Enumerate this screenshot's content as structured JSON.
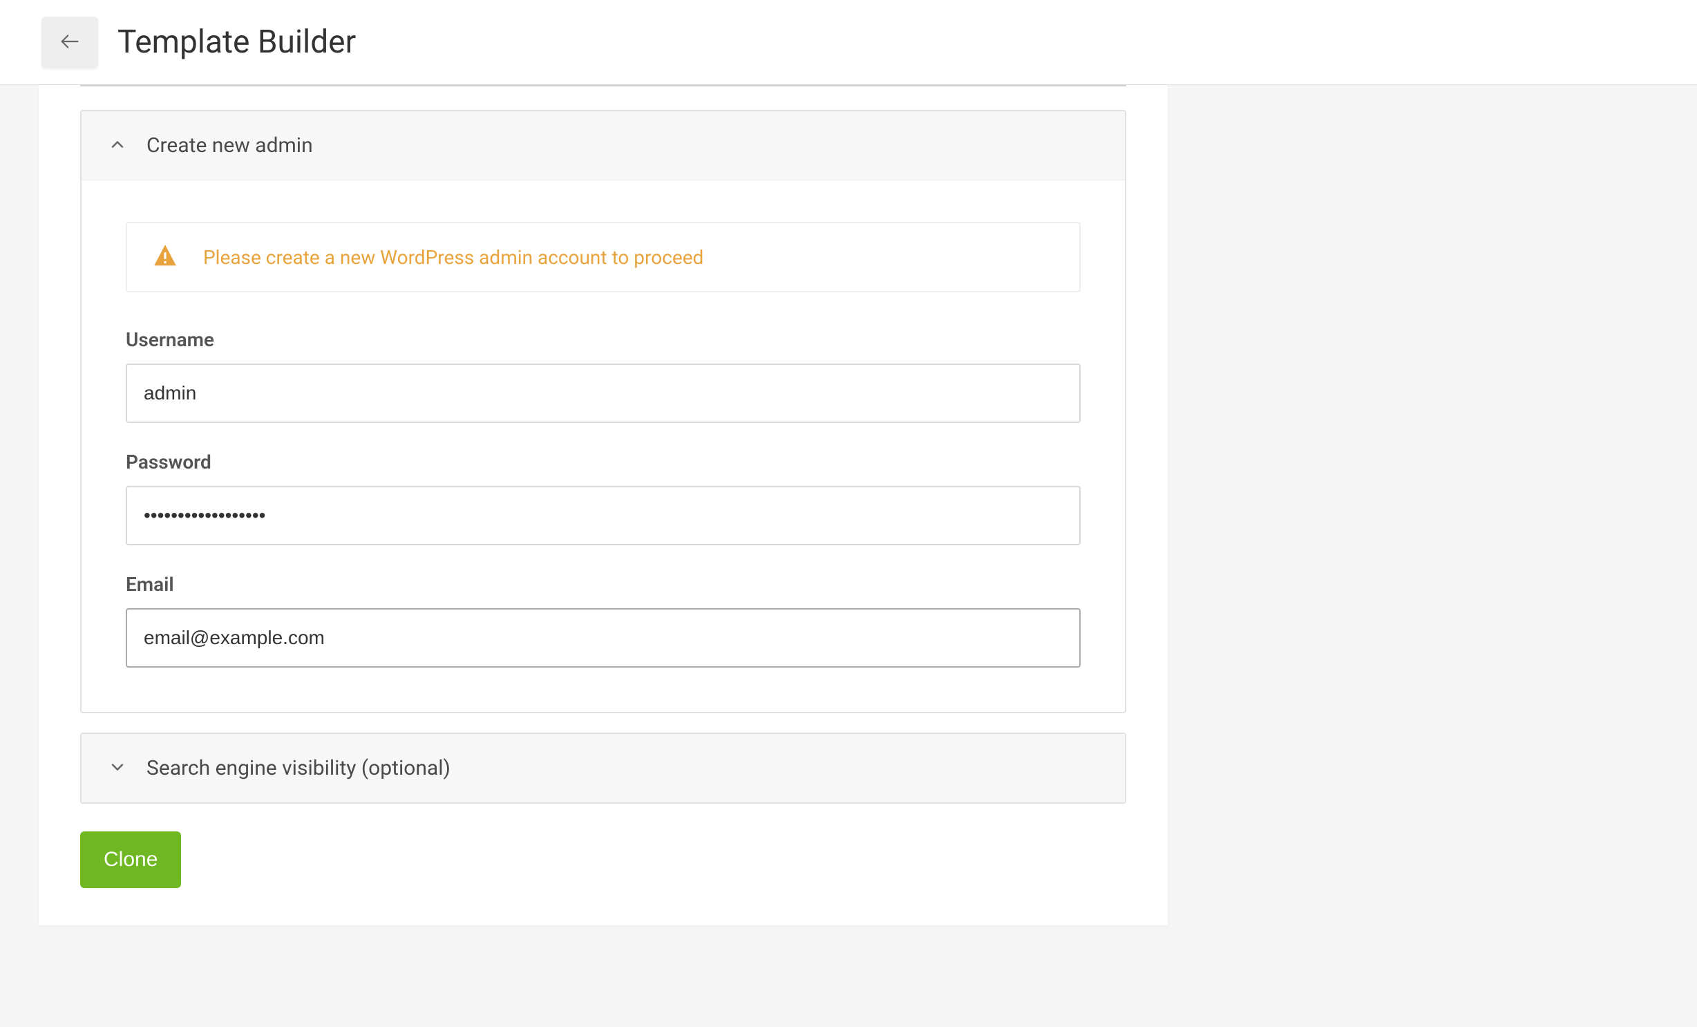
{
  "header": {
    "title": "Template Builder"
  },
  "sections": {
    "create_admin": {
      "title": "Create new admin",
      "alert_text": "Please create a new WordPress admin account to proceed",
      "fields": {
        "username": {
          "label": "Username",
          "value": "admin"
        },
        "password": {
          "label": "Password",
          "value": "••••••••••••••••••"
        },
        "email": {
          "label": "Email",
          "value": "email@example.com"
        }
      }
    },
    "search_visibility": {
      "title": "Search engine visibility (optional)"
    }
  },
  "actions": {
    "clone_label": "Clone"
  }
}
